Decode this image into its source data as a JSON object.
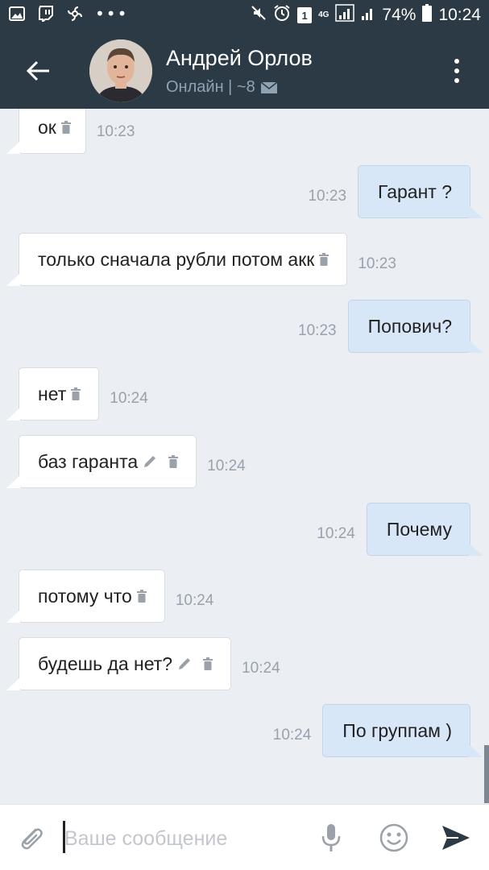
{
  "status_bar": {
    "battery_percent": "74%",
    "time": "10:24",
    "network": "4G",
    "sim_badge": "1"
  },
  "header": {
    "contact_name": "Андрей Орлов",
    "status_text": "Онлайн | ~8"
  },
  "messages": [
    {
      "direction": "in",
      "text": "ок",
      "time": "10:23",
      "edited": false,
      "deleted_icon": true
    },
    {
      "direction": "out",
      "text": "Гарант ?",
      "time": "10:23"
    },
    {
      "direction": "in",
      "text": "только сначала рубли потом акк",
      "time": "10:23",
      "edited": false,
      "deleted_icon": true
    },
    {
      "direction": "out",
      "text": "Попович?",
      "time": "10:23"
    },
    {
      "direction": "in",
      "text": "нет",
      "time": "10:24",
      "edited": false,
      "deleted_icon": true
    },
    {
      "direction": "in",
      "text": "баз гаранта",
      "time": "10:24",
      "edited": true,
      "deleted_icon": true
    },
    {
      "direction": "out",
      "text": "Почему",
      "time": "10:24"
    },
    {
      "direction": "in",
      "text": "потому что",
      "time": "10:24",
      "edited": false,
      "deleted_icon": true
    },
    {
      "direction": "in",
      "text": "будешь да нет?",
      "time": "10:24",
      "edited": true,
      "deleted_icon": true
    },
    {
      "direction": "out",
      "text": "По группам )",
      "time": "10:24"
    }
  ],
  "composer": {
    "placeholder": "Ваше сообщение",
    "value": ""
  },
  "colors": {
    "header_bg": "#2b3a45",
    "chat_bg": "#ebeef2",
    "incoming_bubble": "#ffffff",
    "outgoing_bubble": "#d8e7f8",
    "time_text": "#98a2ad"
  },
  "icons": {
    "back": "arrow-left-icon",
    "more": "more-vertical-icon",
    "attach": "paperclip-icon",
    "mic": "microphone-icon",
    "emoji": "smile-icon",
    "send": "send-icon",
    "trash": "trash-icon",
    "edit": "pencil-icon",
    "mail": "mail-icon"
  }
}
